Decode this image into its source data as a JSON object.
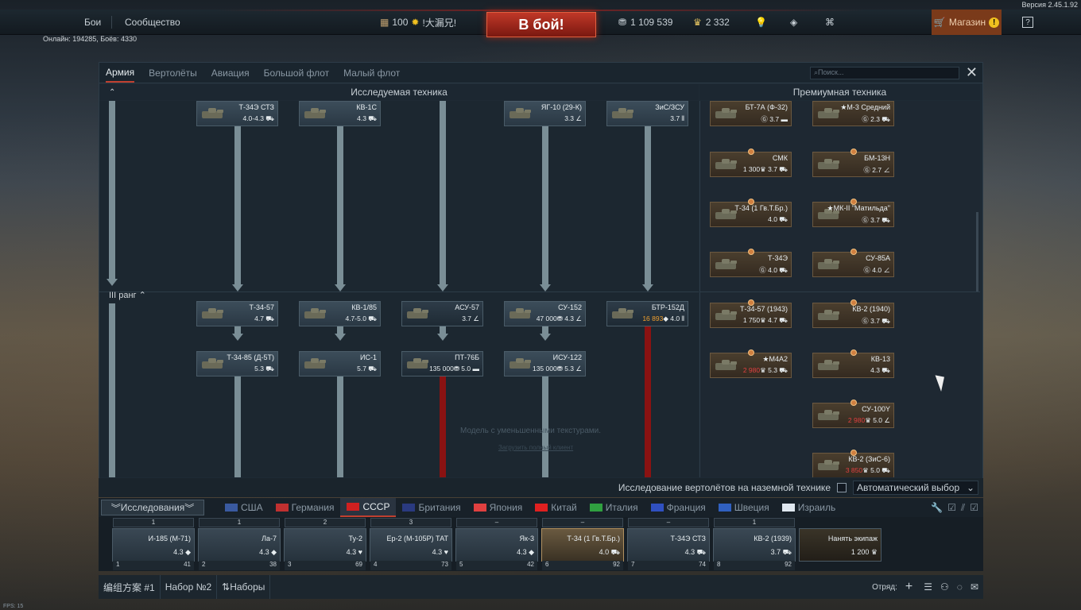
{
  "version": "Версия 2.45.1.92",
  "top": {
    "battles": "Бои",
    "community": "Сообщество",
    "squad": "100",
    "nick": "!大漏兄!",
    "battle_btn": "В бой!",
    "silver": "1 109 539",
    "gold": "2 332",
    "shop": "Магазин",
    "help": "?"
  },
  "online": "Онлайн: 194285, Боёв: 4330",
  "tabs": [
    "Армия",
    "Вертолёты",
    "Авиация",
    "Большой флот",
    "Малый флот"
  ],
  "search_placeholder": "Поиск...",
  "headers": {
    "research": "Исследуемая техника",
    "premium": "Премиумная техника"
  },
  "rank_label": "III ранг",
  "tree": [
    {
      "name": "Т-34Э СТЗ",
      "br": "4.0-4.3"
    },
    {
      "name": "КВ-1С",
      "br": "4.3"
    },
    {
      "name": "ЯГ-10 (29-К)",
      "br": "3.3"
    },
    {
      "name": "ЗиС/ЗСУ",
      "br": "3.7"
    },
    {
      "name": "Т-34-57",
      "br": "4.7"
    },
    {
      "name": "КВ-1/85",
      "br": "4.7-5.0"
    },
    {
      "name": "АСУ-57",
      "br": "3.7"
    },
    {
      "name": "СУ-152",
      "cost": "47 000",
      "br": "4.3"
    },
    {
      "name": "БТР-152Д",
      "cost": "16 893",
      "br": "4.0"
    },
    {
      "name": "Т-34-85 (Д-5Т)",
      "br": "5.3"
    },
    {
      "name": "ИС-1",
      "br": "5.7"
    },
    {
      "name": "ПТ-76Б",
      "cost": "135 000",
      "br": "5.0"
    },
    {
      "name": "ИСУ-122",
      "cost": "135 000",
      "br": "5.3"
    }
  ],
  "premium": [
    {
      "name": "БТ-7А (Ф-32)",
      "br": "3.7"
    },
    {
      "name": "★М-3 Средний",
      "br": "2.3"
    },
    {
      "name": "СМК",
      "cost": "1 300",
      "br": "3.7"
    },
    {
      "name": "БМ-13Н",
      "br": "2.7"
    },
    {
      "name": "Т-34 (1 Гв.Т.Бр.)",
      "br": "4.0"
    },
    {
      "name": "★МК-II \"Матильда\"",
      "br": "3.7"
    },
    {
      "name": "Т-34Э",
      "br": "4.0"
    },
    {
      "name": "СУ-85А",
      "br": "4.0"
    },
    {
      "name": "Т-34-57 (1943)",
      "cost": "1 750",
      "br": "4.7"
    },
    {
      "name": "КВ-2 (1940)",
      "br": "3.7"
    },
    {
      "name": "★M4A2",
      "cost": "2 980",
      "br": "5.3"
    },
    {
      "name": "КВ-13",
      "br": "4.3"
    },
    {
      "name": "СУ-100Y",
      "cost": "2 980",
      "br": "5.0"
    },
    {
      "name": "КВ-2 (ЗиС-6)",
      "cost": "3 850",
      "br": "5.0"
    }
  ],
  "notice": "Модель с уменьшенными текстурами.",
  "notice_link": "Загрузить полный клиент",
  "heli_research": "Исследование вертолётов на наземной технике",
  "auto_select": "Автоматический выбор",
  "research_btn": "Исследования",
  "nations": [
    "США",
    "Германия",
    "СССР",
    "Британия",
    "Япония",
    "Китай",
    "Италия",
    "Франция",
    "Швеция",
    "Израиль"
  ],
  "colors": {
    "usa": "#3a5aa0",
    "germany": "#c03030",
    "ussr": "#d02020",
    "britain": "#2a3a80",
    "japan": "#e04040",
    "china": "#e02020",
    "italy": "#30a040",
    "france": "#3050c0",
    "sweden": "#3060c0",
    "israel": "#e0e8f0"
  },
  "crew": [
    {
      "top": "1",
      "name": "И-185 (М-71)",
      "br": "4.3",
      "num": "1",
      "val": "41"
    },
    {
      "top": "1",
      "name": "Ла-7",
      "br": "4.3",
      "num": "2",
      "val": "38"
    },
    {
      "top": "2",
      "name": "Ту-2",
      "br": "4.3",
      "num": "3",
      "val": "69"
    },
    {
      "top": "3",
      "name": "Ер-2 (М-105Р) ТАТ",
      "br": "4.3",
      "num": "4",
      "val": "73"
    },
    {
      "top": "–",
      "name": "Як-3",
      "br": "4.3",
      "num": "5",
      "val": "42"
    },
    {
      "top": "–",
      "name": "Т-34 (1 Гв.Т.Бр.)",
      "br": "4.0",
      "num": "6",
      "val": "92"
    },
    {
      "top": "–",
      "name": "Т-34Э СТЗ",
      "br": "4.3",
      "num": "7",
      "val": "74"
    },
    {
      "top": "1",
      "name": "КВ-2 (1939)",
      "br": "3.7",
      "num": "8",
      "val": "92"
    }
  ],
  "hire": {
    "label": "Нанять экипаж",
    "cost": "1 200"
  },
  "presets": {
    "p1": "编组方案 #1",
    "p2": "Набор №2",
    "all": "Наборы",
    "squad": "Отряд:"
  },
  "fps": "FPS: 15"
}
